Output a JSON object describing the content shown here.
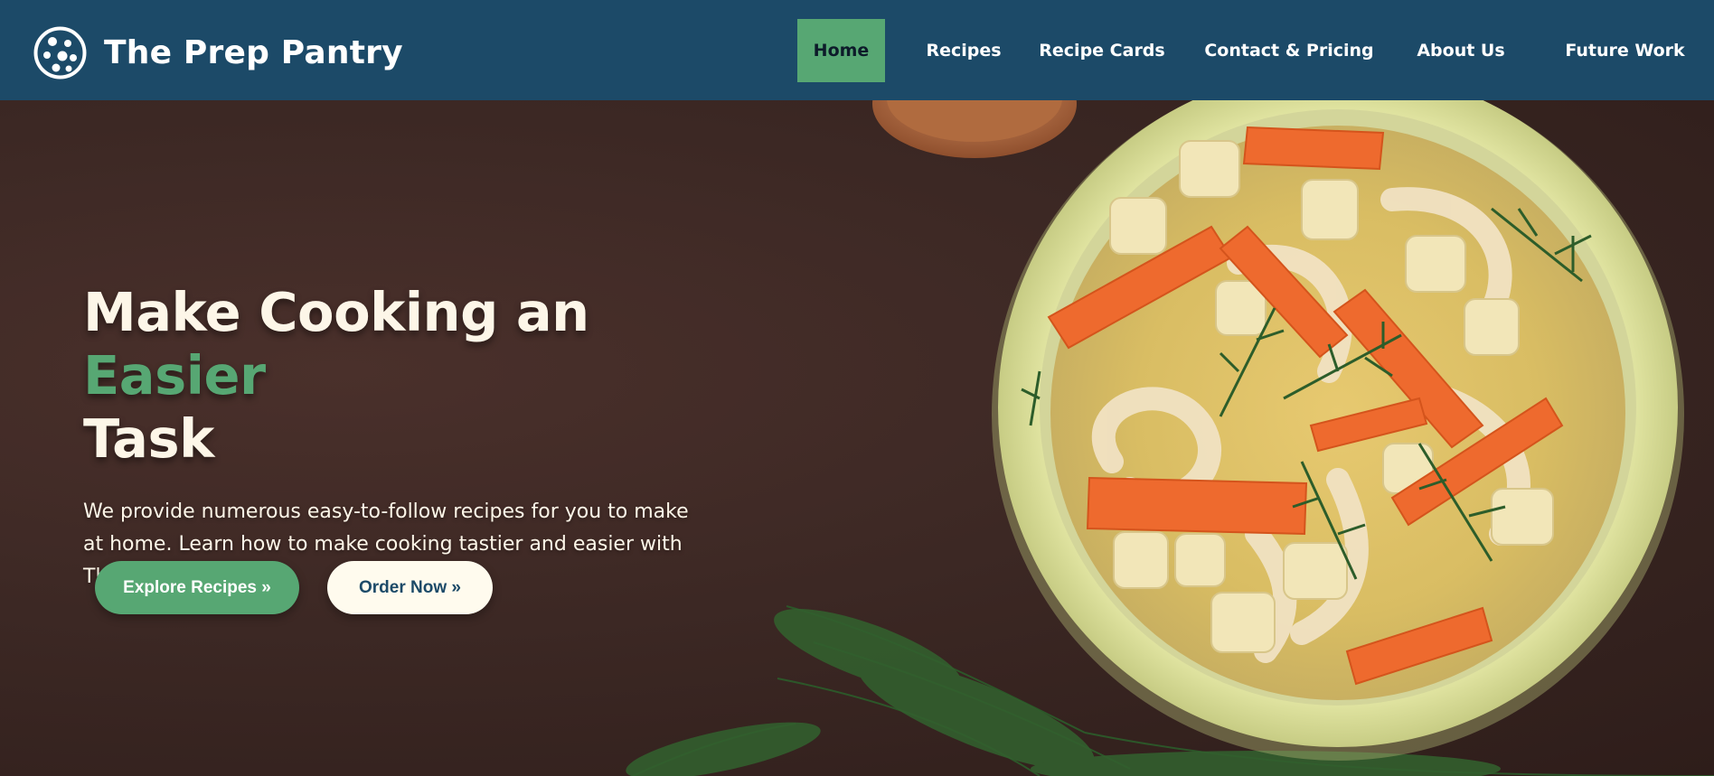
{
  "brand": {
    "name": "The Prep Pantry",
    "logo_icon": "cookie-logo-icon"
  },
  "nav": {
    "items": [
      {
        "label": "Home",
        "active": true
      },
      {
        "label": "Recipes",
        "active": false
      },
      {
        "label": "Recipe Cards",
        "active": false
      },
      {
        "label": "Contact & Pricing",
        "active": false
      },
      {
        "label": "About Us",
        "active": false
      },
      {
        "label": "Future Work",
        "active": false
      }
    ]
  },
  "hero": {
    "title_part1": "Make Cooking an ",
    "title_accent": "Easier",
    "title_part2": "Task",
    "description": "We provide numerous easy-to-follow recipes for you to make at home. Learn how to make cooking tastier and easier with The Prep Pantry!",
    "explore_label": "Explore Recipes »",
    "order_label": "Order Now »",
    "image_subject": "bowl of noodle soup with carrots, potatoes and dill"
  },
  "colors": {
    "nav_bg": "#1c4a68",
    "accent_green": "#57a773",
    "cream": "#fdf6e8",
    "hero_bg": "#3a2622"
  }
}
